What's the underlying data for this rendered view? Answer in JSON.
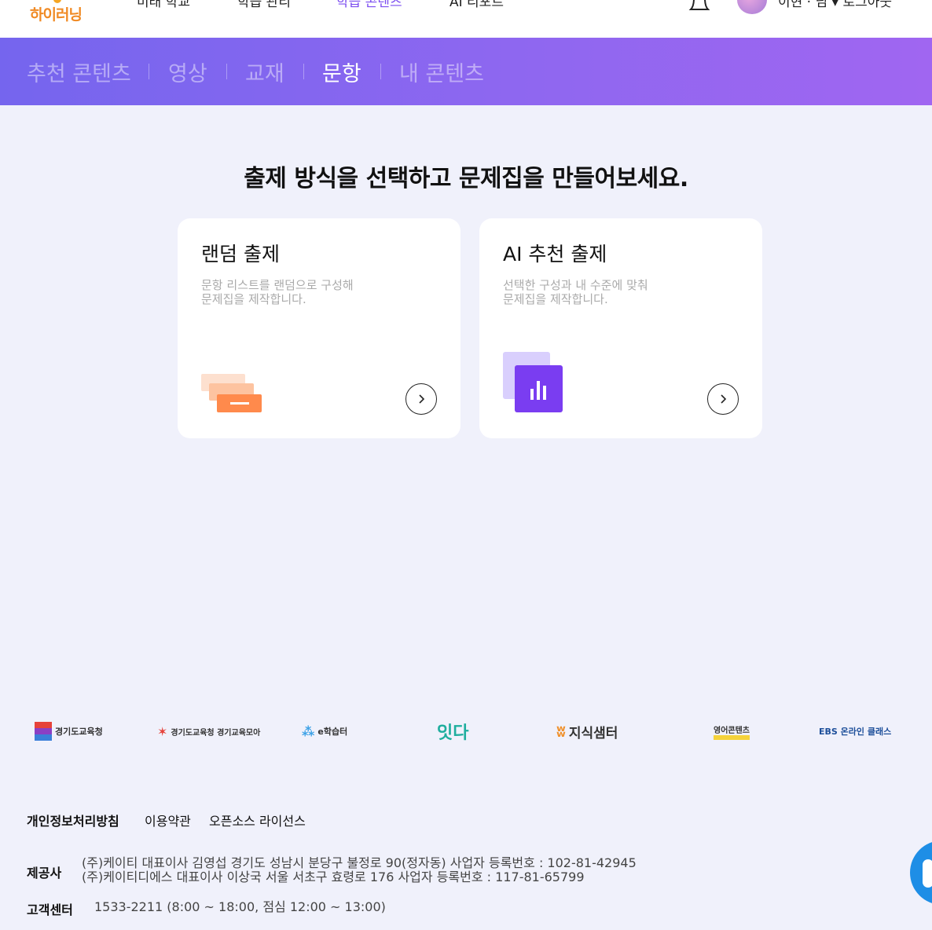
{
  "header": {
    "logo_text": "하이러닝",
    "nav": [
      "미래 학교",
      "학습 관리",
      "학습 콘텐츠",
      "AI 리포트"
    ],
    "active_nav": "학습 콘텐츠",
    "user_text": "이현 · 님  ▾  로그아웃"
  },
  "sub_nav": {
    "tabs": [
      "추천 콘텐츠",
      "영상",
      "교재",
      "문항",
      "내 콘텐츠"
    ],
    "active_tab": "문항"
  },
  "main": {
    "heading": "출제 방식을 선택하고 문제집을 만들어보세요.",
    "cards": [
      {
        "title": "랜덤 출제",
        "desc_line1": "문항 리스트를 랜덤으로 구성해",
        "desc_line2": "문제집을 제작합니다."
      },
      {
        "title": "AI 추천 출제",
        "desc_line1": "선택한 구성과 내 수준에 맞춰",
        "desc_line2": "문제집을 제작합니다."
      }
    ]
  },
  "partners": [
    "경기도교육청",
    "경기도교육청 경기교육모아",
    "e학습터",
    "잇다",
    "지식샘터",
    "영어콘텐츠",
    "EBS 온라인 클래스"
  ],
  "footer": {
    "links": [
      "개인정보처리방침",
      "이용약관",
      "오픈소스 라이선스"
    ],
    "provider_label": "제공사",
    "provider_line1": "(주)케이티 대표이사 김영섭 경기도 성남시 분당구 불정로 90(정자동) 사업자 등록번호 : 102-81-42945",
    "provider_line2": "(주)케이티디에스 대표이사 이상국 서울 서초구 효령로 176 사업자 등록번호 : 117-81-65799",
    "cs_label": "고객센터",
    "cs_text": "1533-2211 (8:00 ~ 18:00, 점심 12:00 ~ 13:00)"
  },
  "colors": {
    "accent": "#7b4cf0",
    "subnav_start": "#7565ee",
    "subnav_end": "#a066f1",
    "random_orange": "#ff8a4c",
    "ai_purple": "#7a3df1"
  }
}
